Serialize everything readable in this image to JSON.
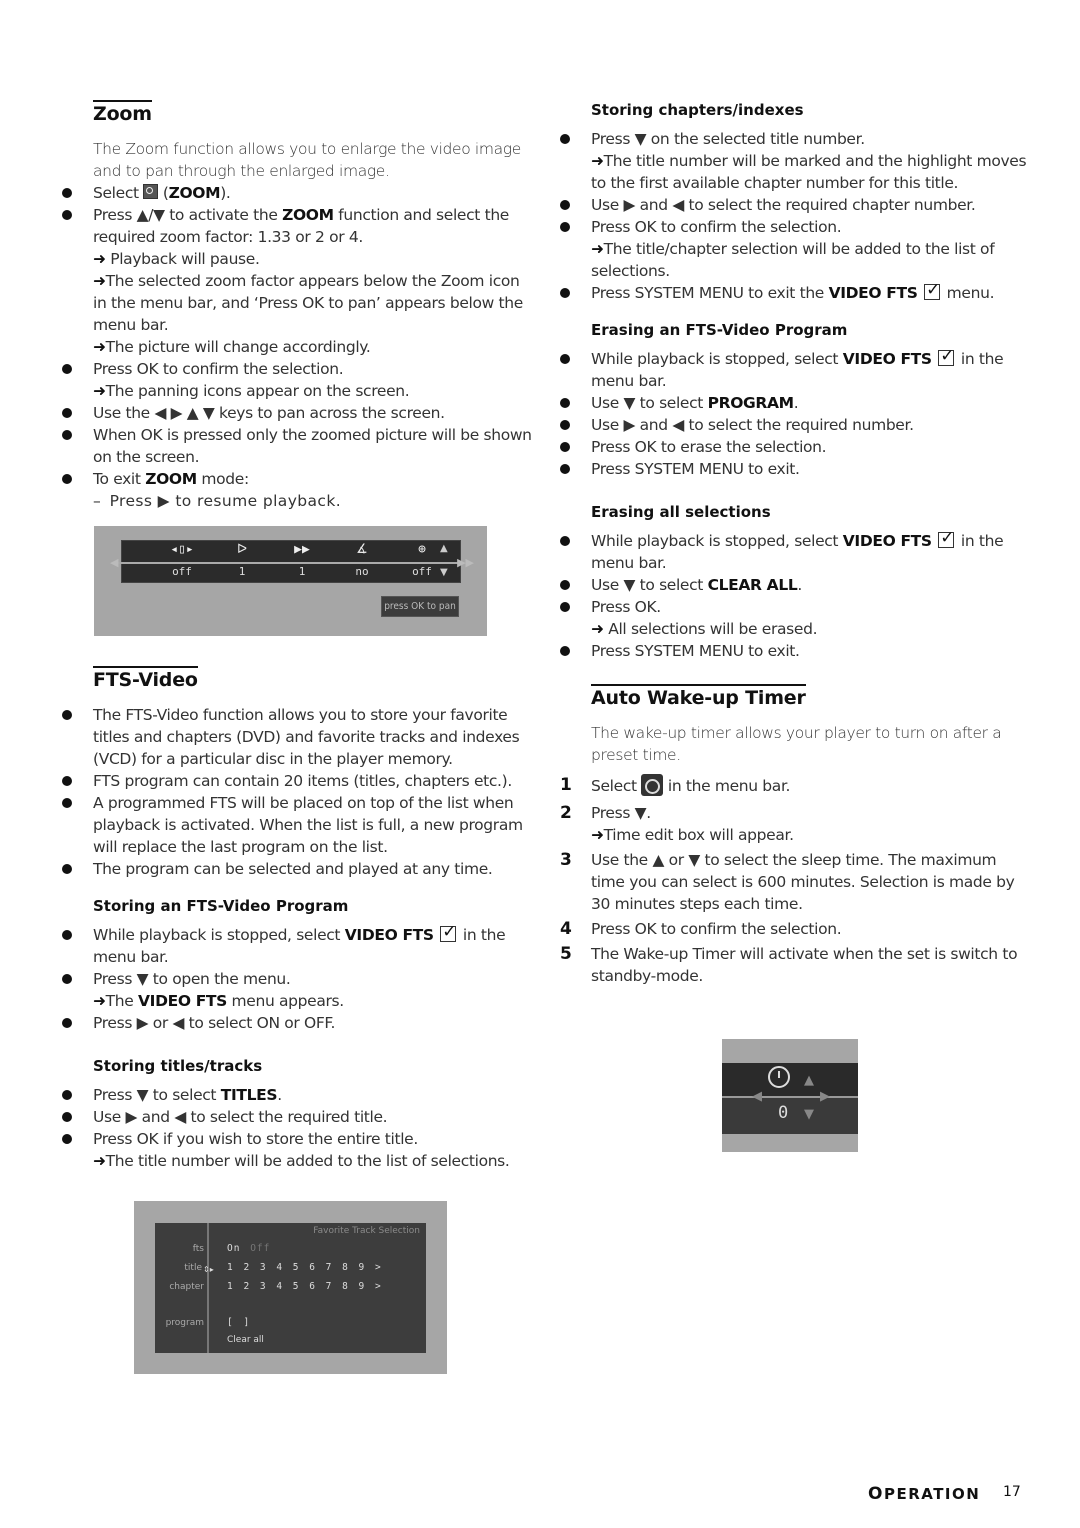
{
  "zoom": {
    "title": "Zoom",
    "intro": "The Zoom function allows you to enlarge the video image and to pan through the enlarged image.",
    "items": [
      {
        "pre": "Select ",
        "icon": "zoom-icon",
        "bold": "ZOOM",
        "post": ")."
      },
      {
        "text": "Press ▲/▼ to activate the ",
        "bold": "ZOOM",
        "post": " function and select the required zoom factor: 1.33 or 2 or 4.",
        "results": [
          "Playback will pause.",
          "The selected zoom factor appears below the Zoom icon in the menu bar, and ‘Press OK to pan’ appears below the menu bar.",
          "The picture will change accordingly."
        ]
      },
      {
        "text": "Press OK to confirm the selection.",
        "results": [
          "The panning icons appear on the screen."
        ]
      },
      {
        "text": "Use the ◀ ▶ ▲ ▼ keys to pan across the screen."
      },
      {
        "text": "When OK is pressed only the zoomed picture will be shown on the screen."
      },
      {
        "pre": "To exit ",
        "bold": "ZOOM",
        "post": " mode:",
        "dash": "Press ▶ to resume playback."
      }
    ],
    "arrow": "➜"
  },
  "zoom_screen": {
    "icons": [
      "◂▯▸",
      "ᐅ",
      "▶▶",
      "∡",
      "⊕"
    ],
    "values": [
      "off",
      "1",
      "1",
      "no",
      "off"
    ],
    "hint": "press OK to pan"
  },
  "fts": {
    "title": "FTS-Video",
    "items": [
      "The FTS-Video function allows you to store your favorite titles and chapters (DVD) and favorite tracks and indexes (VCD) for a particular disc in the player memory.",
      "FTS program can contain 20 items (titles, chapters etc.).",
      "A programmed FTS will be placed on top of the list when playback is activated. When the list is full, a new program will replace the last program on the list.",
      "The program can be selected and played at any time."
    ],
    "storing_program": {
      "title": "Storing an FTS-Video Program",
      "i1_pre": "While playback is stopped, select ",
      "i1_bold": "VIDEO FTS",
      "i1_post": " in the menu bar.",
      "i2": "Press ▼ to open the menu.",
      "i2_res_pre": "The ",
      "i2_res_bold": "VIDEO FTS",
      "i2_res_post": " menu appears.",
      "i3": "Press ▶ or ◀  to select ON or OFF."
    },
    "storing_titles": {
      "title": "Storing titles/tracks",
      "i1_pre": "Press ▼ to select ",
      "i1_bold": "TITLES",
      "i1_post": ".",
      "i2": "Use ▶ and ◀ to select the required title.",
      "i3": "Press OK if you wish to store the entire title.",
      "i3_res": "The title number will be added to the list of selections."
    }
  },
  "fts_screen": {
    "header": "Favorite Track Selection",
    "labels": [
      "fts",
      "title",
      "chapter",
      "program"
    ],
    "fts_on": "On",
    "fts_off": "Off",
    "title_row": "1 2 3 4 5 6 7 8 9 >",
    "chapter_row": "1 2 3 4 5 6 7 8 9 >",
    "program_row": "[ ]",
    "clear_all": "Clear all"
  },
  "right": {
    "storing_chapters": {
      "title": "Storing chapters/indexes",
      "i1": "Press ▼ on the selected title number.",
      "i1_res": "The title number will be marked and the highlight moves to the first available chapter number for this title.",
      "i2": "Use ▶ and ◀ to select the required chapter number.",
      "i3": "Press OK to confirm the selection.",
      "i3_res": "The title/chapter selection will be added to the list of selections.",
      "i4_pre": "Press SYSTEM MENU to exit the ",
      "i4_bold": "VIDEO FTS",
      "i4_post": " menu."
    },
    "erasing_program": {
      "title": "Erasing an FTS-Video Program",
      "i1_pre": "While playback is stopped, select ",
      "i1_bold": "VIDEO FTS",
      "i1_post": " in the menu bar.",
      "i2_pre": "Use ▼ to select ",
      "i2_bold": "PROGRAM",
      "i2_post": ".",
      "i3": "Use ▶ and ◀ to select the required number.",
      "i4": "Press OK to erase the selection.",
      "i5": "Press SYSTEM MENU to exit."
    },
    "erasing_all": {
      "title": "Erasing all selections",
      "i1_pre": "While playback is stopped, select ",
      "i1_bold": "VIDEO FTS",
      "i1_post": " in the menu bar.",
      "i2_pre": "Use ▼ to select ",
      "i2_bold": "CLEAR ALL",
      "i2_post": ".",
      "i3": "Press OK.",
      "i3_res": "All selections will be erased.",
      "i4": "Press SYSTEM MENU to exit."
    },
    "timer": {
      "title": "Auto Wake-up Timer",
      "intro": "The wake-up timer allows your player to turn on after a preset time.",
      "steps": [
        {
          "n": "1",
          "pre": "Select ",
          "post": " in the menu bar."
        },
        {
          "n": "2",
          "text": "Press ▼.",
          "res": "Time edit box will appear."
        },
        {
          "n": "3",
          "text": "Use the ▲  or  ▼  to select the sleep time. The maximum time you can select is 600 minutes. Selection is made by 30 minutes steps each time."
        },
        {
          "n": "4",
          "text": "Press OK to confirm the selection."
        },
        {
          "n": "5",
          "text": "The Wake-up Timer will activate when the set is switch to standby-mode."
        }
      ]
    }
  },
  "timer_screen": {
    "value": "0",
    "up": "▲",
    "down": "▼",
    "left": "◀",
    "right": "▶"
  },
  "footer": {
    "section_first": "O",
    "section_rest": "PERATION",
    "page": "17"
  }
}
